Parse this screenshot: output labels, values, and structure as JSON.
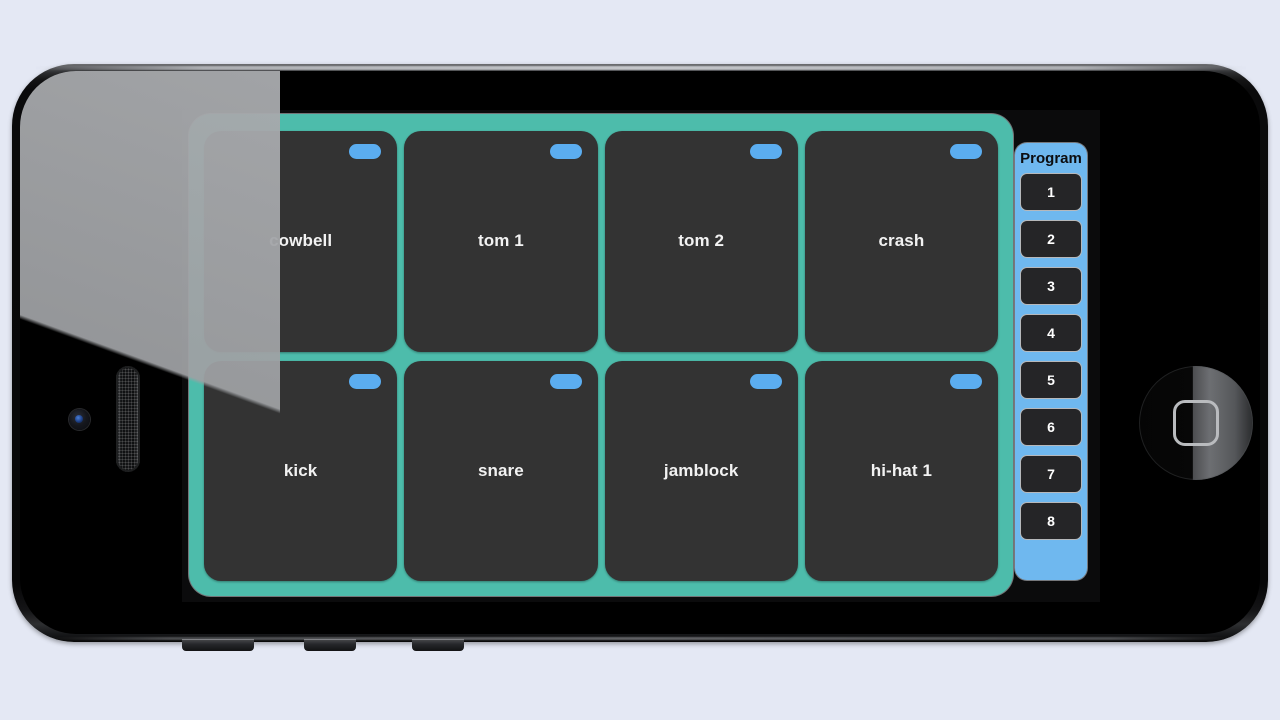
{
  "background_color": "#e4e8f4",
  "device": {
    "name": "smartphone-landscape",
    "frame_color": "#0a0a0b",
    "home_button_label": "home-button",
    "speaker_label": "earpiece-speaker",
    "camera_label": "front-camera"
  },
  "app": {
    "panel_color": "#4dbcab",
    "pad_color": "#333333",
    "chip_color": "#5badf0",
    "pads": [
      {
        "label": "cowbell",
        "chip": true
      },
      {
        "label": "tom 1",
        "chip": true
      },
      {
        "label": "tom 2",
        "chip": true
      },
      {
        "label": "crash",
        "chip": true
      },
      {
        "label": "kick",
        "chip": true
      },
      {
        "label": "snare",
        "chip": true
      },
      {
        "label": "jamblock",
        "chip": true
      },
      {
        "label": "hi-hat 1",
        "chip": true
      }
    ],
    "program": {
      "title": "Program",
      "panel_color": "#6fb8ef",
      "button_color": "#252527",
      "buttons": [
        {
          "label": "1"
        },
        {
          "label": "2"
        },
        {
          "label": "3"
        },
        {
          "label": "4"
        },
        {
          "label": "5"
        },
        {
          "label": "6"
        },
        {
          "label": "7"
        },
        {
          "label": "8"
        }
      ]
    }
  }
}
